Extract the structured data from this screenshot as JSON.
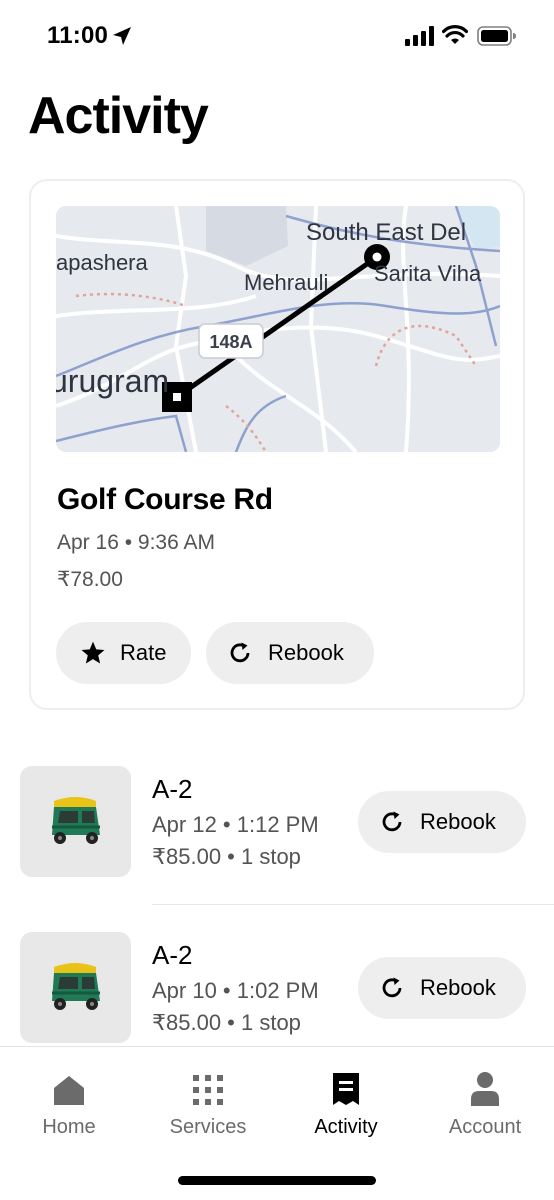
{
  "status_bar": {
    "time": "11:00",
    "icons": [
      "location-arrow-icon",
      "cellular-signal-icon",
      "wifi-icon",
      "battery-icon"
    ]
  },
  "page_title": "Activity",
  "featured_trip": {
    "map_labels": [
      "South East Del",
      "apashera",
      "Mehrauli",
      "Sarita Viha",
      "148A",
      "urugram"
    ],
    "destination": "Golf Course Rd",
    "datetime": "Apr 16 • 9:36 AM",
    "price": "₹78.00",
    "rate_label": "Rate",
    "rebook_label": "Rebook"
  },
  "past_trips": [
    {
      "name": "A-2",
      "datetime": "Apr 12 • 1:12 PM",
      "price_stops": "₹85.00 • 1 stop",
      "rebook_label": "Rebook",
      "thumb_icon": "auto-rickshaw-icon"
    },
    {
      "name": "A-2",
      "datetime": "Apr 10 • 1:02 PM",
      "price_stops": "₹85.00 • 1 stop",
      "rebook_label": "Rebook",
      "thumb_icon": "auto-rickshaw-icon"
    }
  ],
  "bottom_nav": {
    "items": [
      {
        "label": "Home",
        "icon": "home-icon",
        "active": false
      },
      {
        "label": "Services",
        "icon": "grid-icon",
        "active": false
      },
      {
        "label": "Activity",
        "icon": "receipt-icon",
        "active": true
      },
      {
        "label": "Account",
        "icon": "person-icon",
        "active": false
      }
    ]
  },
  "colors": {
    "primary": "#000000",
    "secondary_text": "#545454",
    "pill_background": "#eeeeee",
    "inactive_nav": "#6b6b6b"
  }
}
